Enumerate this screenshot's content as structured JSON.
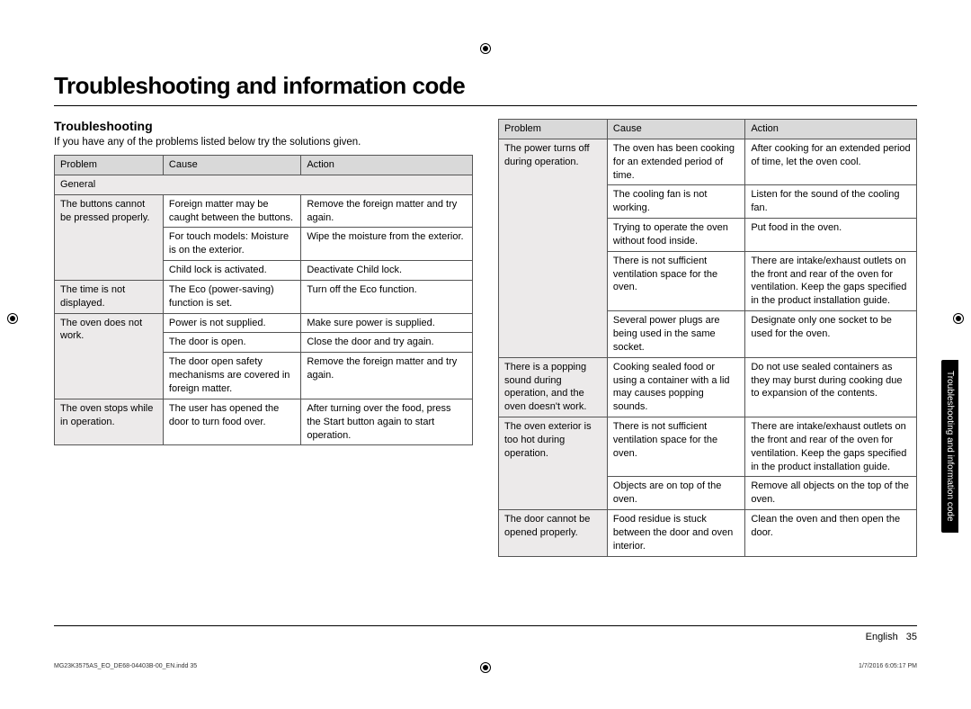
{
  "title": "Troubleshooting and information code",
  "section": "Troubleshooting",
  "intro": "If you have any of the problems listed below try the solutions given.",
  "side_tab": "Troubleshooting and information code",
  "page_lang": "English",
  "page_num": "35",
  "footer_left": "MG23K3575AS_EO_DE68-04403B-00_EN.indd   35",
  "footer_right": "1/7/2016   6:05:17 PM",
  "headers": {
    "problem": "Problem",
    "cause": "Cause",
    "action": "Action"
  },
  "group_label": "General",
  "table1": [
    {
      "problem": "The buttons cannot be pressed properly.",
      "rows": [
        {
          "cause": "Foreign matter may be caught between the buttons.",
          "action": "Remove the foreign matter and try again."
        },
        {
          "cause": "For touch models: Moisture is on the exterior.",
          "action": "Wipe the moisture from the exterior."
        },
        {
          "cause": "Child lock is activated.",
          "action": "Deactivate Child lock."
        }
      ]
    },
    {
      "problem": "The time is not displayed.",
      "rows": [
        {
          "cause": "The Eco (power-saving) function is set.",
          "action": "Turn off the Eco function."
        }
      ]
    },
    {
      "problem": "The oven does not work.",
      "rows": [
        {
          "cause": "Power is not supplied.",
          "action": "Make sure power is supplied."
        },
        {
          "cause": "The door is open.",
          "action": "Close the door and try again."
        },
        {
          "cause": "The door open safety mechanisms are covered in foreign matter.",
          "action": "Remove the foreign matter and try again."
        }
      ]
    },
    {
      "problem": "The oven stops while in operation.",
      "rows": [
        {
          "cause": "The user has opened the door to turn food over.",
          "action": "After turning over the food, press the Start button again to start operation."
        }
      ]
    }
  ],
  "table2": [
    {
      "problem": "The power turns off during operation.",
      "rows": [
        {
          "cause": "The oven has been cooking for an extended period of time.",
          "action": "After cooking for an extended period of time, let the oven cool."
        },
        {
          "cause": "The cooling fan is not working.",
          "action": "Listen for the sound of the cooling fan."
        },
        {
          "cause": "Trying to operate the oven without food inside.",
          "action": "Put food in the oven."
        },
        {
          "cause": "There is not sufficient ventilation space for the oven.",
          "action": "There are intake/exhaust outlets on the front and rear of the oven for ventilation. Keep the gaps specified in the product installation guide."
        },
        {
          "cause": "Several power plugs are being used in the same socket.",
          "action": "Designate only one socket to be used for the oven."
        }
      ]
    },
    {
      "problem": "There is a popping sound during operation, and the oven doesn't work.",
      "rows": [
        {
          "cause": "Cooking sealed food or using a container with a lid may causes popping sounds.",
          "action": "Do not use sealed containers as they may burst during cooking due to expansion of the contents."
        }
      ]
    },
    {
      "problem": "The oven exterior is too hot during operation.",
      "rows": [
        {
          "cause": "There is not sufficient ventilation space for the oven.",
          "action": "There are intake/exhaust outlets on the front and rear of the oven for ventilation. Keep the gaps specified in the product installation guide."
        },
        {
          "cause": "Objects are on top of the oven.",
          "action": "Remove all objects on the top of the oven."
        }
      ]
    },
    {
      "problem": "The door cannot be opened properly.",
      "rows": [
        {
          "cause": "Food residue is stuck between the door and oven interior.",
          "action": "Clean the oven and then open the door."
        }
      ]
    }
  ]
}
